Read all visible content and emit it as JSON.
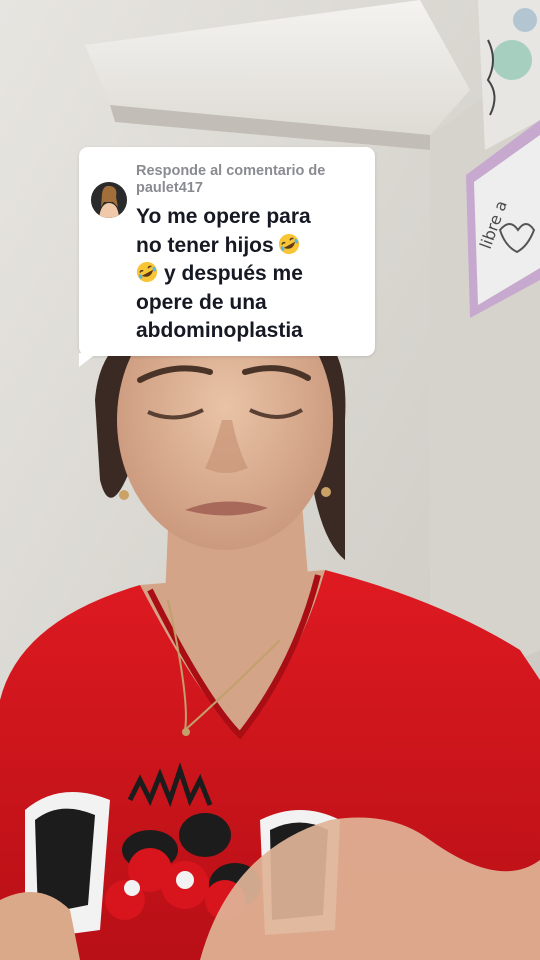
{
  "reply_card": {
    "header_prefix": "Responde al comentario de",
    "username": "paulet417",
    "comment_line1": "Yo me opere para",
    "comment_line2": "no tener hijos",
    "comment_line3": "y después me",
    "comment_line4": "opere de una",
    "comment_line5": "abdominoplastia"
  },
  "icons": {
    "avatar": "user-avatar",
    "emoji": "rolling-on-floor-laughing-emoji"
  },
  "colors": {
    "card_background": "#ffffff",
    "header_text": "#8a8b91",
    "comment_text": "#161823",
    "shirt": "#d8141c"
  }
}
